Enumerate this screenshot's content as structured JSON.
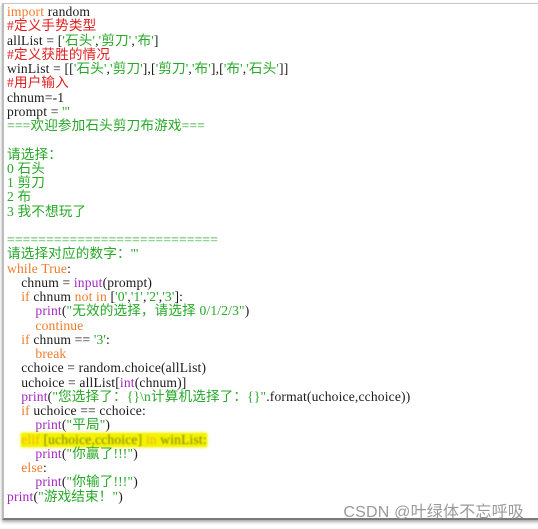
{
  "colors": {
    "keyword": "#f07b2b",
    "comment": "#e02020",
    "string": "#27a827",
    "builtin": "#a328c0",
    "default": "#1a1a1a",
    "highlight": "#f3f300"
  },
  "code": {
    "lines": [
      {
        "tokens": [
          {
            "t": "import",
            "c": "kw"
          },
          {
            "t": " random"
          }
        ]
      },
      {
        "tokens": [
          {
            "t": "#定义手势类型",
            "c": "cm"
          }
        ]
      },
      {
        "tokens": [
          {
            "t": "allList = ["
          },
          {
            "t": "'石头'",
            "c": "st"
          },
          {
            "t": ","
          },
          {
            "t": "'剪刀'",
            "c": "st"
          },
          {
            "t": ","
          },
          {
            "t": "'布'",
            "c": "st"
          },
          {
            "t": "]"
          }
        ]
      },
      {
        "tokens": [
          {
            "t": "#定义获胜的情况",
            "c": "cm"
          }
        ]
      },
      {
        "tokens": [
          {
            "t": "winList = [["
          },
          {
            "t": "'石头'",
            "c": "st"
          },
          {
            "t": ","
          },
          {
            "t": "'剪刀'",
            "c": "st"
          },
          {
            "t": "],["
          },
          {
            "t": "'剪刀'",
            "c": "st"
          },
          {
            "t": ","
          },
          {
            "t": "'布'",
            "c": "st"
          },
          {
            "t": "],["
          },
          {
            "t": "'布'",
            "c": "st"
          },
          {
            "t": ","
          },
          {
            "t": "'石头'",
            "c": "st"
          },
          {
            "t": "]]"
          }
        ]
      },
      {
        "tokens": [
          {
            "t": "#用户输入",
            "c": "cm"
          }
        ]
      },
      {
        "tokens": [
          {
            "t": "chnum=-1"
          }
        ]
      },
      {
        "tokens": [
          {
            "t": "prompt = "
          },
          {
            "t": "'''",
            "c": "st"
          }
        ]
      },
      {
        "tokens": [
          {
            "t": "===欢迎参加石头剪刀布游戏===",
            "c": "st"
          }
        ]
      },
      {
        "tokens": []
      },
      {
        "tokens": [
          {
            "t": "请选择：",
            "c": "st"
          }
        ]
      },
      {
        "tokens": [
          {
            "t": "0 石头",
            "c": "st"
          }
        ]
      },
      {
        "tokens": [
          {
            "t": "1 剪刀",
            "c": "st"
          }
        ]
      },
      {
        "tokens": [
          {
            "t": "2 布",
            "c": "st"
          }
        ]
      },
      {
        "tokens": [
          {
            "t": "3 我不想玩了",
            "c": "st"
          }
        ]
      },
      {
        "tokens": []
      },
      {
        "tokens": [
          {
            "t": "===========================",
            "c": "st"
          }
        ]
      },
      {
        "tokens": [
          {
            "t": "请选择对应的数字：'''",
            "c": "st"
          }
        ]
      },
      {
        "tokens": [
          {
            "t": "while",
            "c": "kw"
          },
          {
            "t": " "
          },
          {
            "t": "True",
            "c": "kw"
          },
          {
            "t": ":"
          }
        ]
      },
      {
        "tokens": [
          {
            "t": "    chnum = "
          },
          {
            "t": "input",
            "c": "bi"
          },
          {
            "t": "(prompt)"
          }
        ]
      },
      {
        "tokens": [
          {
            "t": "    "
          },
          {
            "t": "if",
            "c": "kw"
          },
          {
            "t": " chnum "
          },
          {
            "t": "not in",
            "c": "kw"
          },
          {
            "t": " ["
          },
          {
            "t": "'0'",
            "c": "st"
          },
          {
            "t": ","
          },
          {
            "t": "'1'",
            "c": "st"
          },
          {
            "t": ","
          },
          {
            "t": "'2'",
            "c": "st"
          },
          {
            "t": ","
          },
          {
            "t": "'3'",
            "c": "st"
          },
          {
            "t": "]:"
          }
        ]
      },
      {
        "tokens": [
          {
            "t": "        "
          },
          {
            "t": "print",
            "c": "bi"
          },
          {
            "t": "("
          },
          {
            "t": "\"无效的选择，请选择 0/1/2/3\"",
            "c": "st"
          },
          {
            "t": ")"
          }
        ]
      },
      {
        "tokens": [
          {
            "t": "        "
          },
          {
            "t": "continue",
            "c": "kw"
          }
        ]
      },
      {
        "tokens": [
          {
            "t": "    "
          },
          {
            "t": "if",
            "c": "kw"
          },
          {
            "t": " chnum == "
          },
          {
            "t": "'3'",
            "c": "st"
          },
          {
            "t": ":"
          }
        ]
      },
      {
        "tokens": [
          {
            "t": "        "
          },
          {
            "t": "break",
            "c": "kw"
          }
        ]
      },
      {
        "tokens": [
          {
            "t": "    cchoice = random.choice(allList)"
          }
        ]
      },
      {
        "tokens": [
          {
            "t": "    uchoice = allList["
          },
          {
            "t": "int",
            "c": "bi"
          },
          {
            "t": "(chnum)]"
          }
        ]
      },
      {
        "tokens": [
          {
            "t": "    "
          },
          {
            "t": "print",
            "c": "bi"
          },
          {
            "t": "("
          },
          {
            "t": "\"您选择了：{}\\n计算机选择了：{}\"",
            "c": "st"
          },
          {
            "t": ".format(uchoice,cchoice))"
          }
        ]
      },
      {
        "tokens": [
          {
            "t": "    "
          },
          {
            "t": "if",
            "c": "kw"
          },
          {
            "t": " uchoice == cchoice:"
          }
        ]
      },
      {
        "tokens": [
          {
            "t": "        "
          },
          {
            "t": "print",
            "c": "bi"
          },
          {
            "t": "("
          },
          {
            "t": "\"平局\"",
            "c": "st"
          },
          {
            "t": ")"
          }
        ]
      },
      {
        "highlighted": true,
        "indent": "    ",
        "tokens": [
          {
            "t": "elif",
            "c": "kw"
          },
          {
            "t": " "
          },
          {
            "t": "[uchoice,cchoice]"
          },
          {
            "t": " "
          },
          {
            "t": "in",
            "c": "kw"
          },
          {
            "t": " winList:"
          }
        ]
      },
      {
        "tokens": [
          {
            "t": "        "
          },
          {
            "t": "print",
            "c": "bi"
          },
          {
            "t": "("
          },
          {
            "t": "\"你赢了!!!\"",
            "c": "st"
          },
          {
            "t": ")"
          }
        ]
      },
      {
        "tokens": [
          {
            "t": "    "
          },
          {
            "t": "else",
            "c": "kw"
          },
          {
            "t": ":"
          }
        ]
      },
      {
        "tokens": [
          {
            "t": "        "
          },
          {
            "t": "print",
            "c": "bi"
          },
          {
            "t": "("
          },
          {
            "t": "\"你输了!!!\"",
            "c": "st"
          },
          {
            "t": ")"
          }
        ]
      },
      {
        "tokens": [
          {
            "t": "print",
            "c": "bi"
          },
          {
            "t": "("
          },
          {
            "t": "\"游戏结束！\"",
            "c": "st"
          },
          {
            "t": ")"
          }
        ]
      }
    ]
  },
  "watermark": "CSDN @叶绿体不忘呼吸"
}
